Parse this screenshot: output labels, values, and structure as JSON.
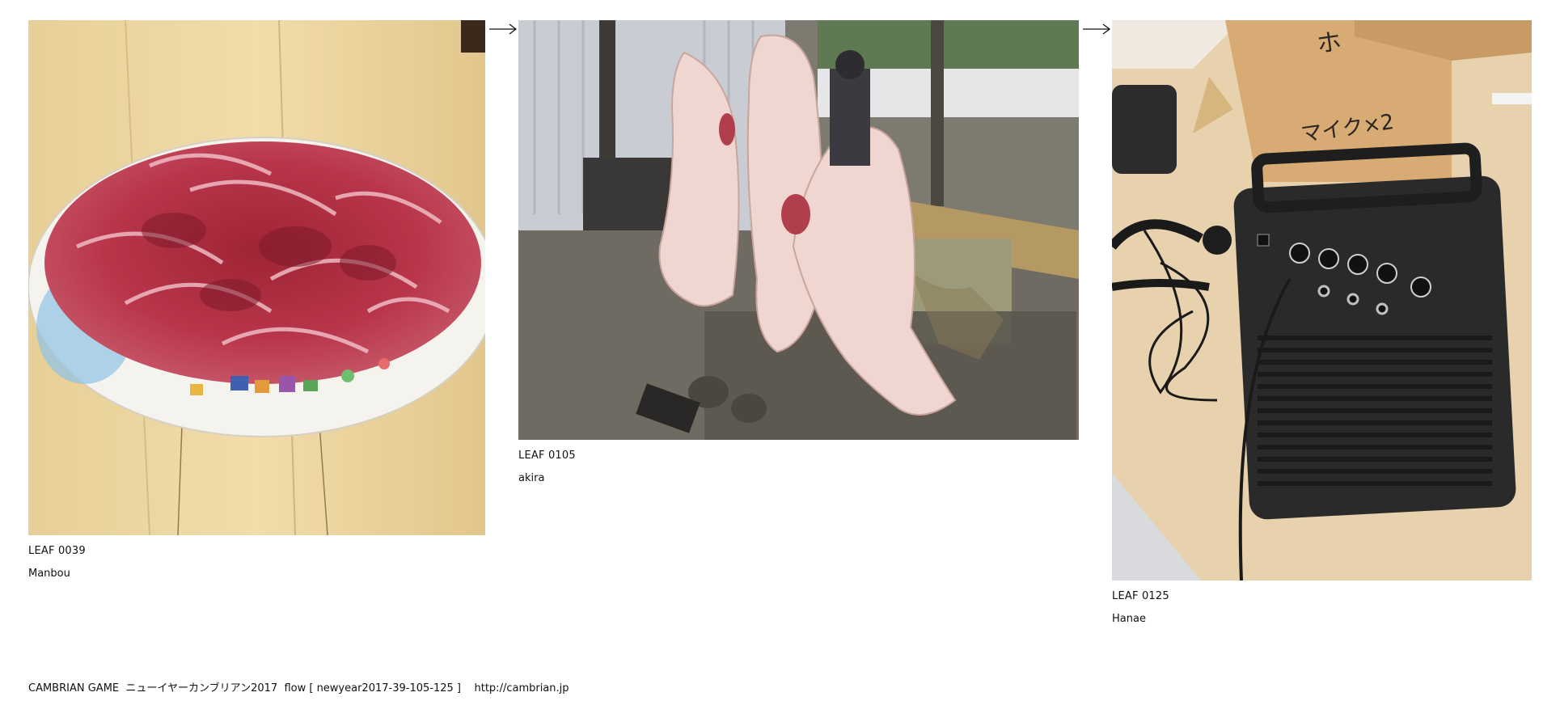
{
  "leaves": [
    {
      "id": "LEAF 0039",
      "author": "Manbou",
      "photo_icon": "plate-of-sliced-meat-photo"
    },
    {
      "id": "LEAF 0105",
      "author": "akira",
      "photo_icon": "hanging-pig-carcasses-photo"
    },
    {
      "id": "LEAF 0125",
      "author": "Hanae",
      "photo_icon": "portable-speaker-with-microphones-photo"
    }
  ],
  "arrows": [
    "right-arrow-icon",
    "right-arrow-icon"
  ],
  "footer": {
    "game": "CAMBRIAN GAME",
    "event": "ニューイヤーカンブリアン2017",
    "flow": "flow [ newyear2017-39-105-125 ]",
    "url": "http://cambrian.jp"
  }
}
